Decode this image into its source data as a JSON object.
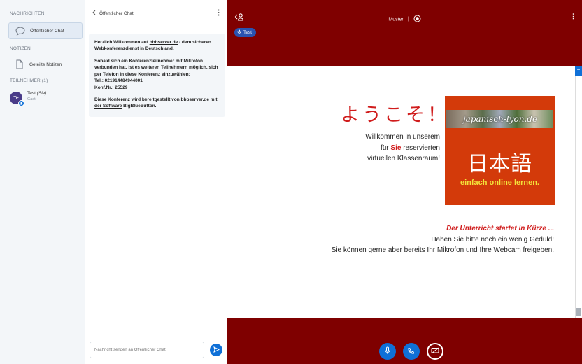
{
  "sidebar": {
    "messages_title": "NACHRICHTEN",
    "public_chat_label": "Öffentlicher Chat",
    "notes_title": "NOTIZEN",
    "shared_notes_label": "Geteilte Notizen",
    "participants_title": "TEILNEHMER (1)",
    "user": {
      "initials": "Te",
      "name": "Test",
      "self_tag": "(Sie)",
      "role": "Gast"
    }
  },
  "chat": {
    "header_title": "Öffentlicher Chat",
    "welcome": {
      "p1_prefix": "Herzlich Willkommen auf ",
      "p1_link": "bbbserver.de",
      "p1_suffix": " - dem sicheren Webkonferenzdienst in Deutschland.",
      "p2": "Sobald sich ein Konferenzteilnehmer mit Mikrofon verbunden hat, ist es weiteren Teilnehmern möglich, sich per Telefon in diese Konferenz einzuwählen:",
      "tel": "Tel.: 021914484944001",
      "conf": "Konf.Nr.: 25529",
      "p3_prefix": "Diese Konferenz wird bereitgestellt von ",
      "p3_link": "bbbserver.de mit der Software",
      "p3_suffix": " BigBlueButton."
    },
    "input_placeholder": "Nachricht senden an Öffentlicher Chat"
  },
  "main": {
    "meeting_title": "Muster",
    "talker_name": "Test",
    "slide": {
      "jp_welcome": "ようこそ！",
      "de_line1": "Willkommen in unserem",
      "de_line2_pre": "für ",
      "de_line2_hl": "Sie",
      "de_line2_post": " reservierten",
      "de_line3": "virtuellen Klassenraum!",
      "logo_banner": "japanisch-lyon.de",
      "logo_kanji": "日本語",
      "logo_tagline": "einfach online lernen.",
      "closing_red": "Der Unterricht startet in Kürze ...",
      "closing_2": "Haben Sie bitte noch ein wenig Geduld!",
      "closing_3": "Sie können gerne aber bereits Ihr Mikrofon und Ihre Webcam freigeben."
    }
  },
  "colors": {
    "brand_dark_red": "#7f0000",
    "primary_blue": "#0f70d7",
    "slide_red": "#d01c1c",
    "logo_orange": "#d33a0a"
  },
  "icons": [
    "chat-icon",
    "notes-icon",
    "back-chevron-icon",
    "kebab-menu-icon",
    "send-icon",
    "users-toggle-icon",
    "record-icon",
    "microphone-icon",
    "phone-icon",
    "screen-share-icon"
  ]
}
